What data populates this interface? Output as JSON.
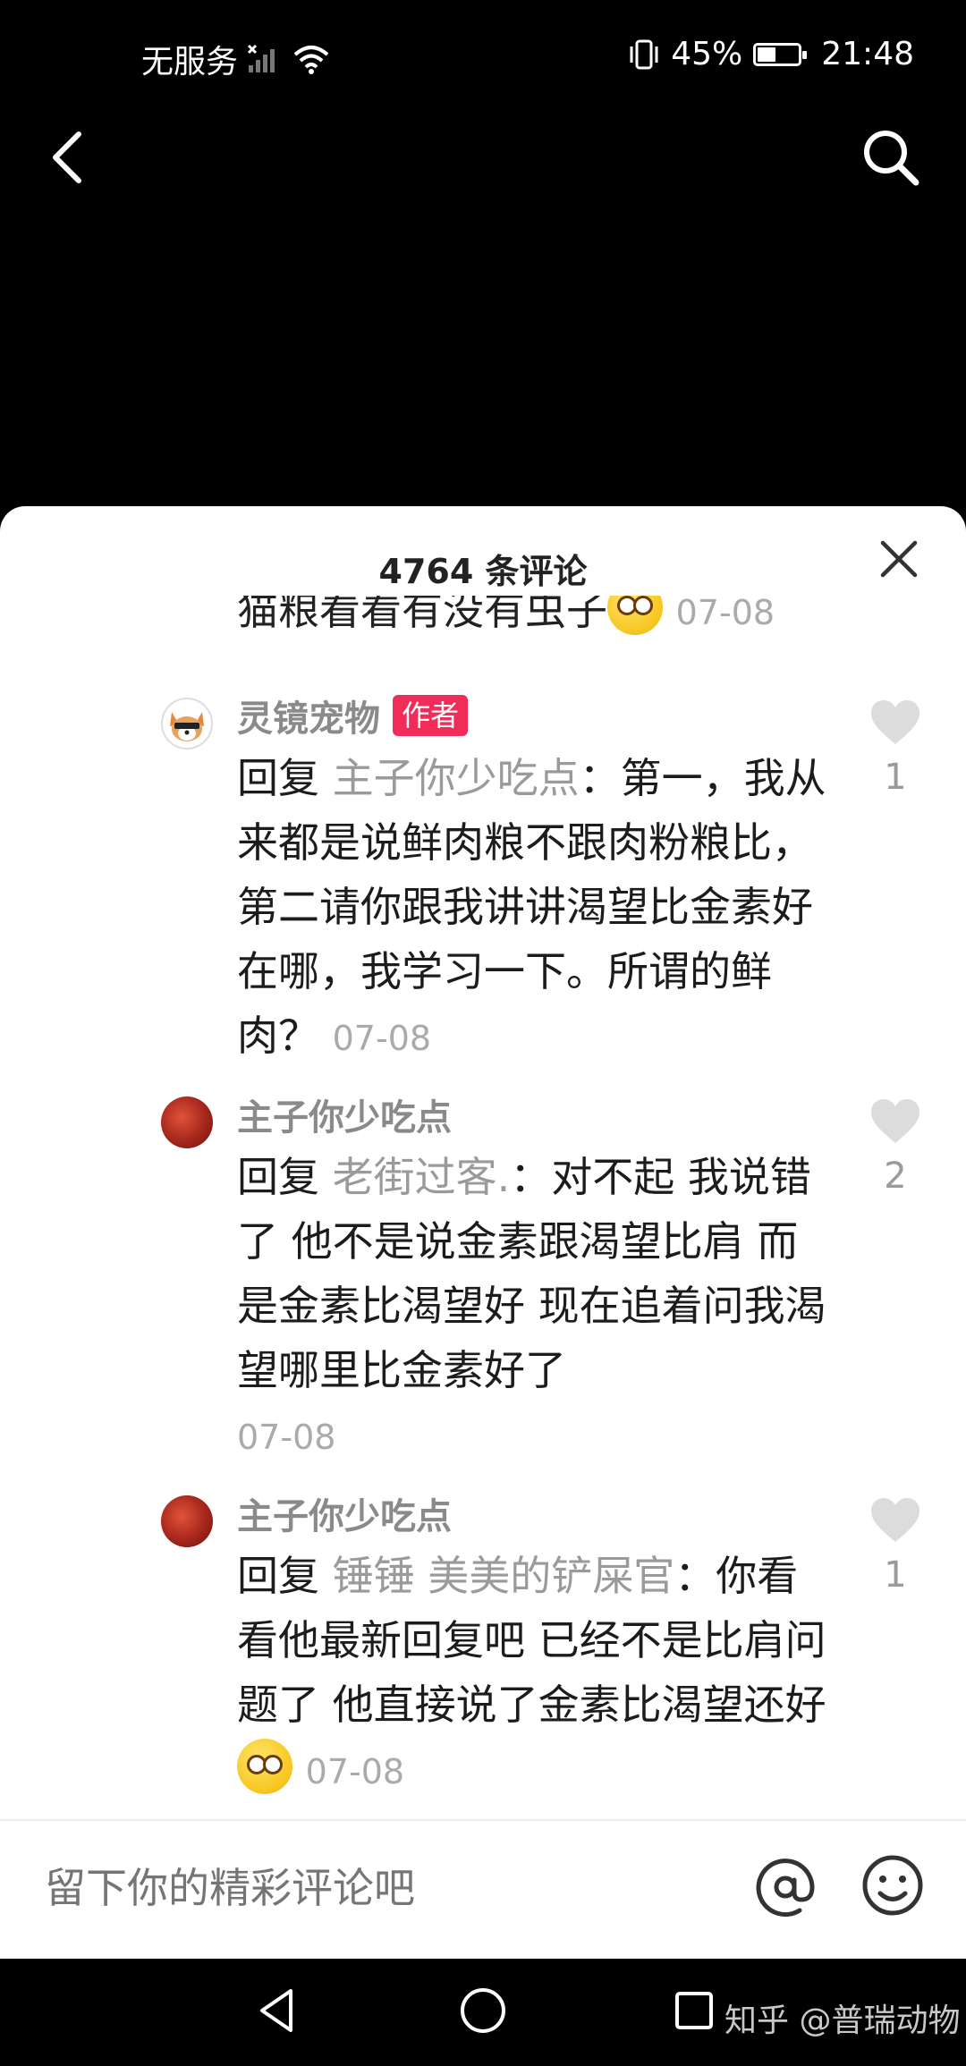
{
  "status_bar": {
    "carrier": "无服务",
    "battery_percent": "45%",
    "battery_level": 0.45,
    "time": "21:48"
  },
  "comments_sheet": {
    "title": "4764 条评论",
    "partial_comment": {
      "text": "猫粮看看有没有虫子",
      "date": "07-08"
    },
    "comments": [
      {
        "username": "灵镜宠物",
        "badge": "作者",
        "reply_prefix": "回复 ",
        "reply_to": "主子你少吃点",
        "text": "：第一，我从来都是说鲜肉粮不跟肉粉粮比，第二请你跟我讲讲渴望比金素好在哪，我学习一下。所谓的鲜肉？",
        "date": "07-08",
        "likes": "1"
      },
      {
        "username": "主子你少吃点",
        "reply_prefix": "回复 ",
        "reply_to": "老街过客.",
        "text": "：对不起 我说错了 他不是说金素跟渴望比肩 而是金素比渴望好 现在追着问我渴望哪里比金素好了",
        "date": "07-08",
        "likes": "2"
      },
      {
        "username": "主子你少吃点",
        "reply_prefix": "回复 ",
        "reply_to": "锤锤 美美的铲屎官",
        "text": "：你看看他最新回复吧 已经不是比肩问题了 他直接说了金素比渴望还好",
        "date": "07-08",
        "likes": "1"
      }
    ],
    "input_placeholder": "留下你的精彩评论吧"
  },
  "icons": {
    "back": "back-arrow-icon",
    "search": "search-icon",
    "close": "close-icon",
    "like": "heart-icon",
    "at": "at-icon",
    "emoji": "emoji-icon"
  },
  "watermark": "知乎 @普瑞动物",
  "colors": {
    "badge": "#f02d58",
    "sheet_bg": "#ffffff",
    "top_bg": "#000000"
  }
}
